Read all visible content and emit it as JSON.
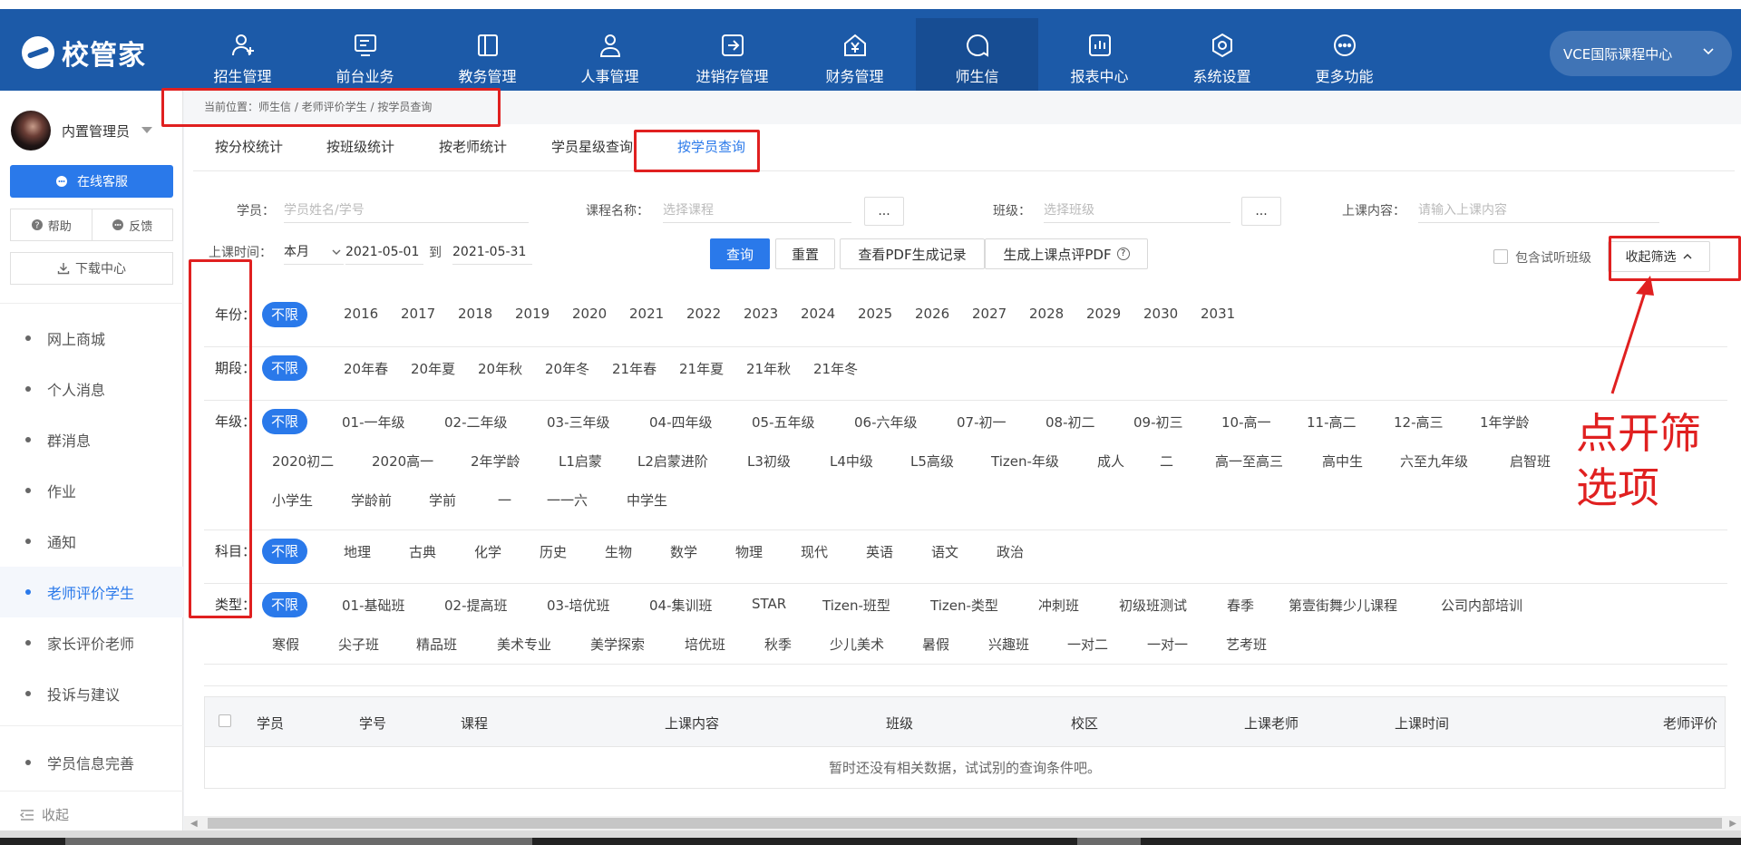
{
  "nav": {
    "logo_text": "校管家",
    "items": [
      {
        "label": "招生管理",
        "icon": "user-add-icon"
      },
      {
        "label": "前台业务",
        "icon": "monitor-icon"
      },
      {
        "label": "教务管理",
        "icon": "book-icon"
      },
      {
        "label": "人事管理",
        "icon": "person-icon"
      },
      {
        "label": "进销存管理",
        "icon": "export-box-icon"
      },
      {
        "label": "财务管理",
        "icon": "yen-house-icon"
      },
      {
        "label": "师生信",
        "icon": "chat-icon",
        "active": true
      },
      {
        "label": "报表中心",
        "icon": "chart-icon"
      },
      {
        "label": "系统设置",
        "icon": "settings-icon"
      },
      {
        "label": "更多功能",
        "icon": "more-icon"
      }
    ],
    "campus": "VCE国际课程中心"
  },
  "sidebar": {
    "user_name": "内置管理员",
    "service_button": "在线客服",
    "help": "帮助",
    "feedback": "反馈",
    "download": "下载中心",
    "menu": [
      "网上商城",
      "个人消息",
      "群消息",
      "作业",
      "通知",
      "老师评价学生",
      "家长评价老师",
      "投诉与建议"
    ],
    "active_menu": "老师评价学生",
    "menu_bottom": [
      "学员信息完善"
    ],
    "collapse": "收起"
  },
  "breadcrumb": "当前位置：师生信 / 老师评价学生 / 按学员查询",
  "tabs": [
    "按分校统计",
    "按班级统计",
    "按老师统计",
    "学员星级查询",
    "按学员查询"
  ],
  "active_tab": "按学员查询",
  "filters": {
    "student_label": "学员：",
    "student_placeholder": "学员姓名/学号",
    "course_label": "课程名称：",
    "course_placeholder": "选择课程",
    "class_label": "班级：",
    "class_placeholder": "选择班级",
    "content_label": "上课内容：",
    "content_placeholder": "请输入上课内容",
    "dots": "...",
    "time_label": "上课时间：",
    "period": "本月",
    "date_from": "2021-05-01",
    "to": "到",
    "date_to": "2021-05-31",
    "query": "查询",
    "reset": "重置",
    "view_pdf": "查看PDF生成记录",
    "gen_pdf": "生成上课点评PDF",
    "question": "?",
    "include_trial": "包含试听班级",
    "collapse_filter": "收起筛选"
  },
  "groups": [
    {
      "label": "年份：",
      "options": [
        "不限",
        "2016",
        "2017",
        "2018",
        "2019",
        "2020",
        "2021",
        "2022",
        "2023",
        "2024",
        "2025",
        "2026",
        "2027",
        "2028",
        "2029",
        "2030",
        "2031"
      ]
    },
    {
      "label": "期段：",
      "options": [
        "不限",
        "20年春",
        "20年夏",
        "20年秋",
        "20年冬",
        "21年春",
        "21年夏",
        "21年秋",
        "21年冬"
      ]
    },
    {
      "label": "年级：",
      "rows": [
        [
          "不限",
          "01-一年级",
          "02-二年级",
          "03-三年级",
          "04-四年级",
          "05-五年级",
          "06-六年级",
          "07-初一",
          "08-初二",
          "09-初三",
          "10-高一",
          "11-高二",
          "12-高三",
          "1年学龄"
        ],
        [
          "2020初二",
          "2020高一",
          "2年学龄",
          "L1启蒙",
          "L2启蒙进阶",
          "L3初级",
          "L4中级",
          "L5高级",
          "Tizen-年级",
          "成人",
          "二",
          "高一至高三",
          "高中生",
          "六至九年级",
          "启智班"
        ],
        [
          "小学生",
          "学龄前",
          "学前",
          "一",
          "一一六",
          "中学生"
        ]
      ]
    },
    {
      "label": "科目：",
      "options": [
        "不限",
        "地理",
        "古典",
        "化学",
        "历史",
        "生物",
        "数学",
        "物理",
        "现代",
        "英语",
        "语文",
        "政治"
      ]
    },
    {
      "label": "类型：",
      "rows": [
        [
          "不限",
          "01-基础班",
          "02-提高班",
          "03-培优班",
          "04-集训班",
          "STAR",
          "Tizen-班型",
          "Tizen-类型",
          "冲刺班",
          "初级班测试",
          "春季",
          "第壹街舞少儿课程",
          "公司内部培训"
        ],
        [
          "寒假",
          "尖子班",
          "精品班",
          "美术专业",
          "美学探索",
          "培优班",
          "秋季",
          "少儿美术",
          "暑假",
          "兴趣班",
          "一对二",
          "一对一",
          "艺考班"
        ]
      ]
    }
  ],
  "table": {
    "columns": [
      "学员",
      "学号",
      "课程",
      "上课内容",
      "班级",
      "校区",
      "上课老师",
      "上课时间",
      "老师评价"
    ],
    "empty": "暂时还没有相关数据，试试别的查询条件吧。"
  },
  "annotation": {
    "line1": "点开筛",
    "line2": "选项",
    "color": "#e02020"
  }
}
